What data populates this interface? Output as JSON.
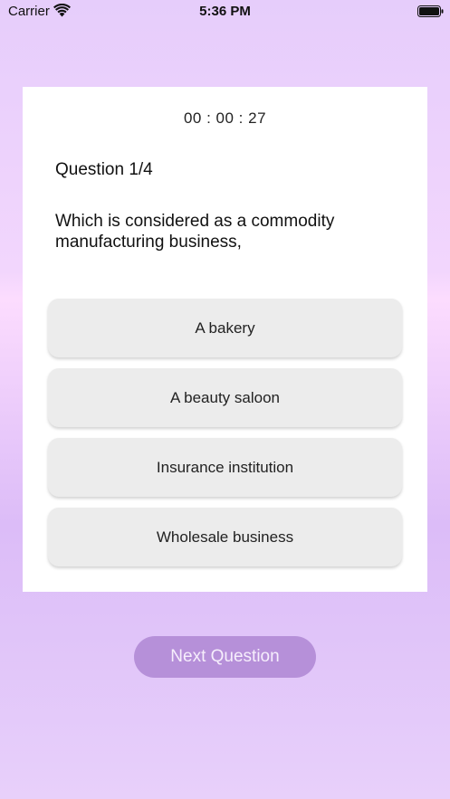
{
  "status_bar": {
    "carrier": "Carrier",
    "time": "5:36 PM"
  },
  "quiz": {
    "timer": "00 : 00 : 27",
    "question_number": "Question 1/4",
    "question_text": "Which is considered as a commodity manufacturing business,",
    "options": [
      "A bakery",
      "A beauty saloon",
      "Insurance institution",
      "Wholesale business"
    ]
  },
  "next_button": {
    "label": "Next Question"
  },
  "colors": {
    "card": "#ffffff",
    "option_bg": "#ececec",
    "button_bg": "#b690d9"
  }
}
